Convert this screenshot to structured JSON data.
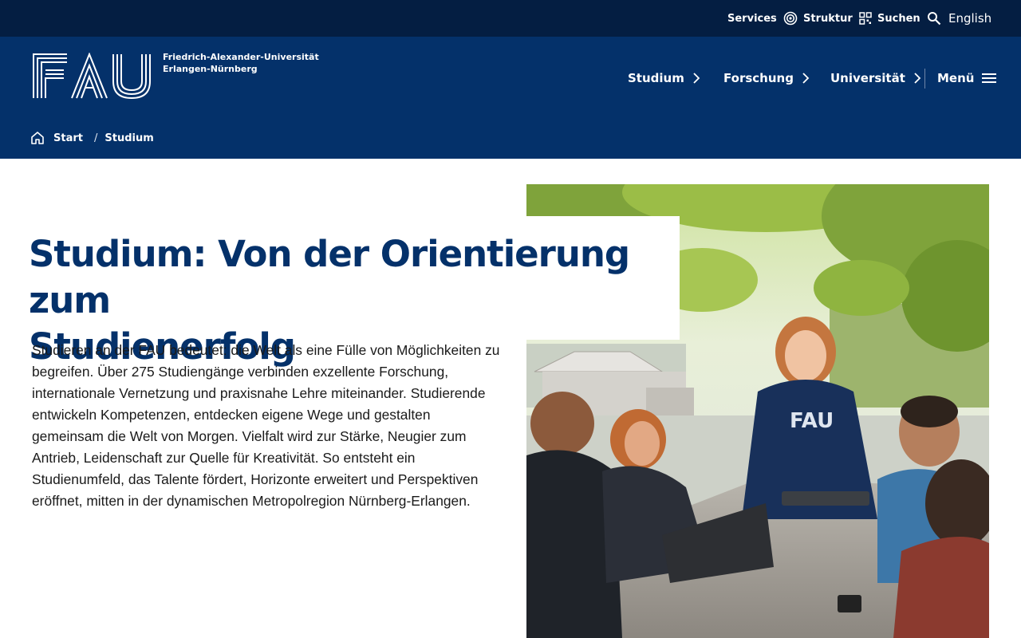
{
  "topbar": {
    "services": "Services",
    "struktur": "Struktur",
    "suchen": "Suchen",
    "english": "English"
  },
  "header": {
    "university_line1": "Friedrich-Alexander-Universität",
    "university_line2": "Erlangen-Nürnberg",
    "logo_text": "FAU",
    "nav": {
      "studium": "Studium",
      "forschung": "Forschung",
      "universitaet": "Universität",
      "menu": "Menü"
    },
    "breadcrumb": {
      "start": "Start",
      "separator": "/",
      "current": "Studium"
    }
  },
  "main": {
    "title_line1": "Studium: Von der Orientierung zum",
    "title_line2": "Studienerfolg",
    "intro": "Studieren an der FAU bedeutet: die Welt als eine Fülle von Möglichkeiten zu begreifen. Über 275 Studiengänge verbinden exzellente Forschung, internationale Vernetzung und praxisnahe Lehre miteinander. Studierende entwickeln Kompetenzen, entdecken eigene Wege und gestalten gemeinsam die Welt von Morgen. Vielfalt wird zur Stärke, Neugier zum Antrieb, Leidenschaft zur Quelle für Kreativität. So entsteht ein Studienumfeld, das Talente fördert, Horizonte erweitert und Perspektiven eröffnet, mitten in der dynamischen Metropolregion Nürnberg-Erlangen.",
    "hoodie_print": "FAU"
  },
  "colors": {
    "topbar_bg": "#041e42",
    "header_bg": "#04316a",
    "title_text": "#04316a"
  },
  "icons": [
    "services-icon",
    "struktur-icon",
    "search-icon",
    "chevron-right-icon",
    "hamburger-menu-icon",
    "home-icon"
  ]
}
